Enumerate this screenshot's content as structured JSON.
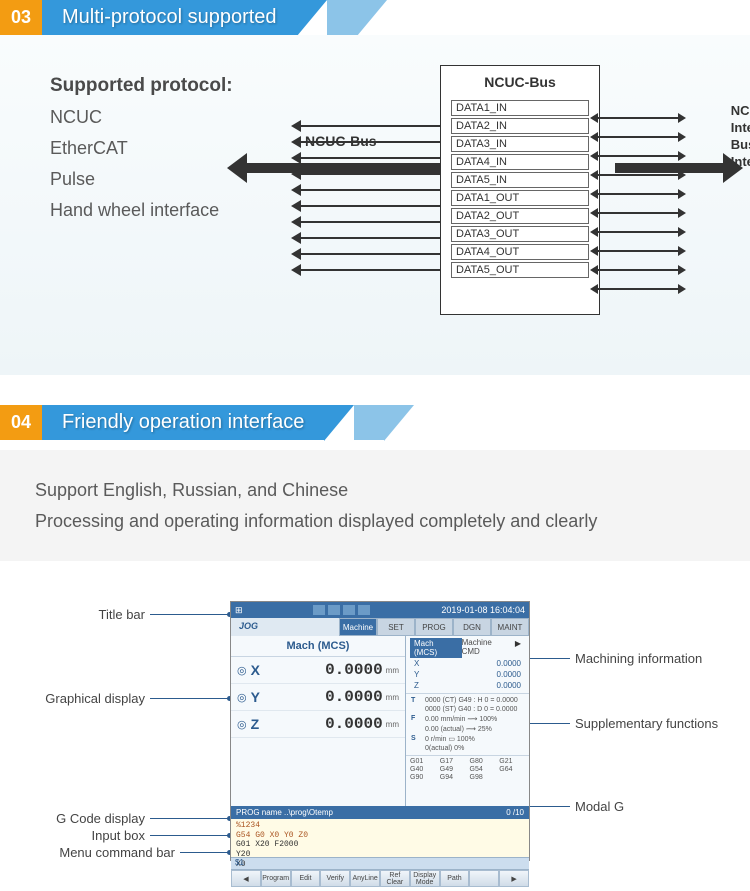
{
  "section03": {
    "num": "03",
    "title": "Multi-protocol supported",
    "heading": "Supported protocol:",
    "items": [
      "NCUC",
      "EtherCAT",
      "Pulse",
      "Hand wheel interface"
    ],
    "busTitle": "NCUC-Bus",
    "busLabelLeft": "NCUC-Bus",
    "busLabelRight": "NCUC\nInternal\nBus\nInterface",
    "dataLines": [
      "DATA1_IN",
      "DATA2_IN",
      "DATA3_IN",
      "DATA4_IN",
      "DATA5_IN",
      "DATA1_OUT",
      "DATA2_OUT",
      "DATA3_OUT",
      "DATA4_OUT",
      "DATA5_OUT"
    ]
  },
  "section04": {
    "num": "04",
    "title": "Friendly operation interface",
    "desc1": "Support English, Russian, and Chinese",
    "desc2": "Processing and operating information displayed completely and clearly"
  },
  "cnc": {
    "datetime": "2019-01-08 16:04:04",
    "mode": "JOG",
    "tabs": [
      "Machine",
      "SET",
      "PROG",
      "DGN",
      "MAINT"
    ],
    "mcsTitle": "Mach  (MCS)",
    "axes": [
      {
        "name": "X",
        "val": "0.0000",
        "unit": "mm"
      },
      {
        "name": "Y",
        "val": "0.0000",
        "unit": "mm"
      },
      {
        "name": "Z",
        "val": "0.0000",
        "unit": "mm"
      }
    ],
    "rightHdr1": "Mach  (MCS)",
    "rightHdr2": "Machine CMD",
    "rightAxes": [
      {
        "n": "X",
        "v": "0.0000"
      },
      {
        "n": "Y",
        "v": "0.0000"
      },
      {
        "n": "Z",
        "v": "0.0000"
      }
    ],
    "tRow1": "0000 (CT)   G49 : H   0 =  0.0000",
    "tRow2": "0000 (ST)   G40 : D   0 =  0.0000",
    "fRow1": "0.00 mm/min   ⟿ 100%",
    "fRow2": "0.00 (actual)   ⟿ 25%",
    "sRow1": "0 r/min   ▭ 100%",
    "sRow2": "0(actual)   0%",
    "modalG": [
      "G01",
      "G17",
      "G80",
      "G21",
      "G40",
      "G49",
      "G54",
      "G64",
      "G90",
      "G94",
      "G98",
      ""
    ],
    "progHeader": "PROG name  ..\\prog\\Otemp",
    "progCount": "0 /10",
    "gcode": [
      "%1234",
      "G54 G0 X0 Y0 Z0",
      "G01 X20 F2000",
      "Y20",
      "X0"
    ],
    "inputPrompt": "$1",
    "menu": [
      "Program",
      "Edit",
      "Verify",
      "AnyLine",
      "Ref Clear",
      "Display Mode",
      "Path",
      ""
    ]
  },
  "callouts": {
    "titleBar": "Title bar",
    "graphical": "Graphical display",
    "gcode": "G Code display",
    "input": "Input box",
    "menucmd": "Menu command bar",
    "machInfo": "Machining information",
    "suppFunc": "Supplementary functions",
    "modalG": "Modal G"
  }
}
